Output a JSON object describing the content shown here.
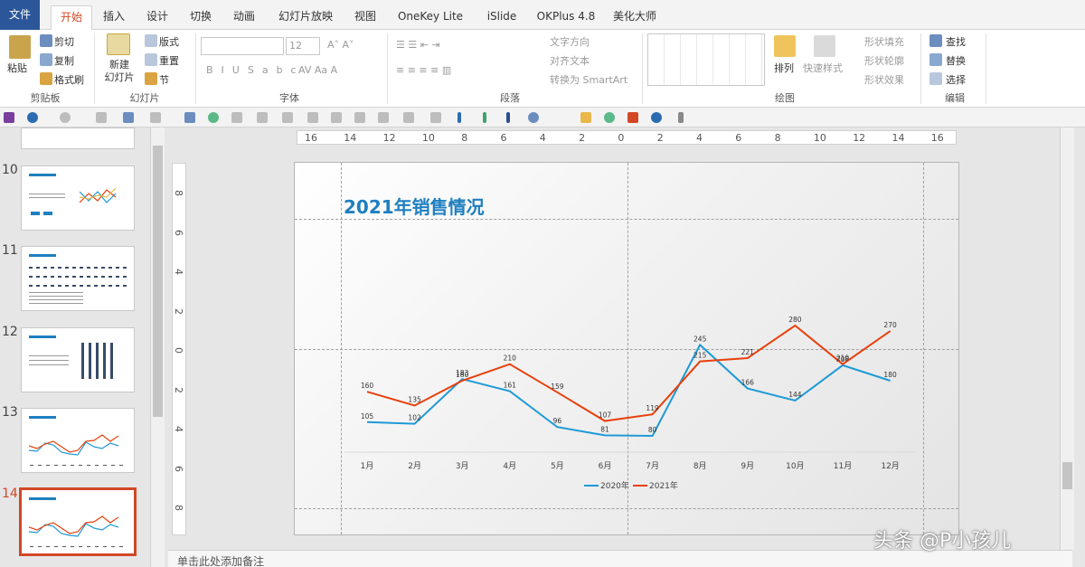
{
  "tabs": [
    {
      "label": "文件",
      "kind": "file"
    },
    {
      "label": "开始",
      "kind": "active"
    },
    {
      "label": "插入"
    },
    {
      "label": "设计"
    },
    {
      "label": "切换"
    },
    {
      "label": "动画"
    },
    {
      "label": "幻灯片放映"
    },
    {
      "label": "视图"
    },
    {
      "label": "OneKey Lite"
    },
    {
      "label": "iSlide"
    },
    {
      "label": "OKPlus 4.8"
    },
    {
      "label": "美化大师"
    }
  ],
  "ribbon": {
    "clipboard": {
      "paste": "粘贴",
      "cut": "剪切",
      "copy": "复制",
      "format_painter": "格式刷",
      "group": "剪贴板"
    },
    "slides": {
      "new_slide": "新建\n幻灯片",
      "layout": "版式",
      "reset": "重置",
      "section": "节",
      "group": "幻灯片"
    },
    "font": {
      "size": "12",
      "group": "字体"
    },
    "paragraph": {
      "text_direction": "文字方向",
      "align_text": "对齐文本",
      "smartart": "转换为 SmartArt",
      "group": "段落"
    },
    "drawing": {
      "arrange": "排列",
      "quick_styles": "快速样式",
      "shape_fill": "形状填充",
      "shape_outline": "形状轮廓",
      "shape_effects": "形状效果",
      "group": "绘图"
    },
    "editing": {
      "find": "查找",
      "replace": "替换",
      "select": "选择",
      "group": "编辑"
    }
  },
  "thumbnails": [
    {
      "number": "10"
    },
    {
      "number": "11"
    },
    {
      "number": "12"
    },
    {
      "number": "13"
    },
    {
      "number": "14",
      "selected": true
    }
  ],
  "ruler": {
    "horizontal": [
      "16",
      "14",
      "12",
      "10",
      "8",
      "6",
      "4",
      "2",
      "0",
      "2",
      "4",
      "6",
      "8",
      "10",
      "12",
      "14",
      "16"
    ],
    "vertical": [
      "8",
      "6",
      "4",
      "2",
      "0",
      "2",
      "4",
      "6",
      "8"
    ]
  },
  "slide": {
    "title": "2021年销售情况"
  },
  "chart_data": {
    "type": "line",
    "title": "",
    "categories": [
      "1月",
      "2月",
      "3月",
      "4月",
      "5月",
      "6月",
      "7月",
      "8月",
      "9月",
      "10月",
      "11月",
      "12月"
    ],
    "series": [
      {
        "name": "2020年",
        "color": "#1e9ad6",
        "values": [
          105,
          102,
          183,
          161,
          96,
          81,
          80,
          245,
          166,
          144,
          208,
          180
        ]
      },
      {
        "name": "2021年",
        "color": "#e8400c",
        "values": [
          160,
          135,
          180,
          210,
          159,
          107,
          119,
          215,
          221,
          280,
          210,
          270
        ]
      }
    ],
    "legend": "bottom",
    "grid": false
  },
  "notes": {
    "placeholder": "单击此处添加备注"
  },
  "watermark": "头条 @P小孩儿"
}
